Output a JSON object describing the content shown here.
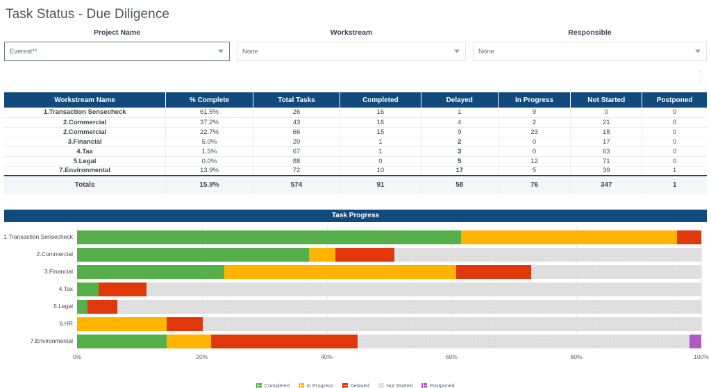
{
  "page_title": "Task Status - Due Diligence",
  "filters": [
    {
      "label": "Project Name",
      "value": "Everest**",
      "style": "primary"
    },
    {
      "label": "Workstream",
      "value": "None",
      "style": "plain"
    },
    {
      "label": "Responsible",
      "value": "None",
      "style": "plain"
    }
  ],
  "table": {
    "columns": [
      "Workstream Name",
      "% Complete",
      "Total Tasks",
      "Completed",
      "Delayed",
      "In Progress",
      "Not Started",
      "Postponed"
    ],
    "rows": [
      {
        "name": "1.Transaction Sensecheck",
        "pct": "61.5%",
        "total": "26",
        "completed": "16",
        "delayed": "1",
        "delayed_highlight": false,
        "in_progress": "9",
        "not_started": "0",
        "postponed": "0"
      },
      {
        "name": "2.Commercial",
        "pct": "37.2%",
        "total": "43",
        "completed": "16",
        "delayed": "4",
        "delayed_highlight": false,
        "in_progress": "2",
        "not_started": "21",
        "postponed": "0"
      },
      {
        "name": "2.Commercial",
        "pct": "22.7%",
        "total": "66",
        "completed": "15",
        "delayed": "9",
        "delayed_highlight": false,
        "in_progress": "23",
        "not_started": "18",
        "postponed": "0"
      },
      {
        "name": "3.Financial",
        "pct": "5.0%",
        "total": "20",
        "completed": "1",
        "delayed": "2",
        "delayed_highlight": true,
        "in_progress": "0",
        "not_started": "17",
        "postponed": "0"
      },
      {
        "name": "4.Tax",
        "pct": "1.5%",
        "total": "67",
        "completed": "1",
        "delayed": "3",
        "delayed_highlight": true,
        "in_progress": "0",
        "not_started": "63",
        "postponed": "0"
      },
      {
        "name": "5.Legal",
        "pct": "0.0%",
        "total": "88",
        "completed": "0",
        "delayed": "5",
        "delayed_highlight": true,
        "in_progress": "12",
        "not_started": "71",
        "postponed": "0"
      },
      {
        "name": "7.Environmental",
        "pct": "13.9%",
        "total": "72",
        "completed": "10",
        "delayed": "17",
        "delayed_highlight": true,
        "in_progress": "5",
        "not_started": "39",
        "postponed": "1"
      }
    ],
    "totals": {
      "name": "Totals",
      "pct": "15.9%",
      "total": "574",
      "completed": "91",
      "delayed": "58",
      "in_progress": "76",
      "not_started": "347",
      "postponed": "1"
    }
  },
  "chart_data": {
    "type": "bar",
    "orientation": "horizontal",
    "stacked": true,
    "normalized": true,
    "title": "Task Progress",
    "xlabel": "",
    "ylabel": "",
    "xlim": [
      0,
      100
    ],
    "xticks": [
      0,
      20,
      40,
      60,
      80,
      100
    ],
    "xtick_labels": [
      "0%",
      "20%",
      "40%",
      "60%",
      "80%",
      "100%"
    ],
    "grid": true,
    "legend_position": "bottom",
    "categories": [
      "1.Transaction Sensecheck",
      "2.Commercial",
      "3.Financial",
      "4.Tax",
      "5.Legal",
      "6.HR",
      "7.Environmental"
    ],
    "series": [
      {
        "name": "Completed",
        "color": "#55b04b",
        "values": [
          61.5,
          37.2,
          23.6,
          3.5,
          1.7,
          0.0,
          14.4
        ]
      },
      {
        "name": "In Progress",
        "color": "#ffb400",
        "values": [
          34.6,
          4.2,
          37.1,
          0.0,
          0.0,
          14.3,
          7.1
        ]
      },
      {
        "name": "Delayed",
        "color": "#e0380a",
        "values": [
          3.9,
          9.4,
          12.1,
          7.6,
          4.8,
          5.8,
          23.4
        ]
      },
      {
        "name": "Not Started",
        "color": "#e0e0e0",
        "values": [
          0.0,
          49.2,
          27.2,
          88.9,
          93.5,
          79.9,
          53.2
        ]
      },
      {
        "name": "Postponed",
        "color": "#b05ac6",
        "values": [
          0.0,
          0.0,
          0.0,
          0.0,
          0.0,
          0.0,
          1.9
        ]
      }
    ]
  },
  "colors": {
    "header_blue": "#114b7d",
    "completed": "#55b04b",
    "in_progress": "#ffb400",
    "delayed": "#e0380a",
    "not_started": "#e0e0e0",
    "postponed": "#b05ac6",
    "delayed_text": "#e8380d"
  }
}
